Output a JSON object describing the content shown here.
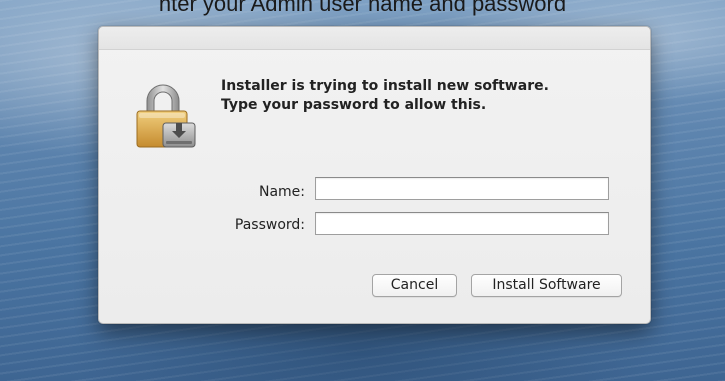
{
  "background": {
    "top_text": "nter your Admin user name and password"
  },
  "dialog": {
    "message_line1": "Installer is trying to install new software.",
    "message_line2": "Type your password to allow this.",
    "icon": "lock-with-download-icon",
    "fields": {
      "name_label": "Name:",
      "name_value": "",
      "password_label": "Password:",
      "password_value": ""
    },
    "buttons": {
      "cancel_label": "Cancel",
      "install_label": "Install Software"
    }
  },
  "colors": {
    "lock_gold": "#d9a64a",
    "lock_shackle": "#b8b8b8",
    "dialog_bg": "#ececec"
  }
}
